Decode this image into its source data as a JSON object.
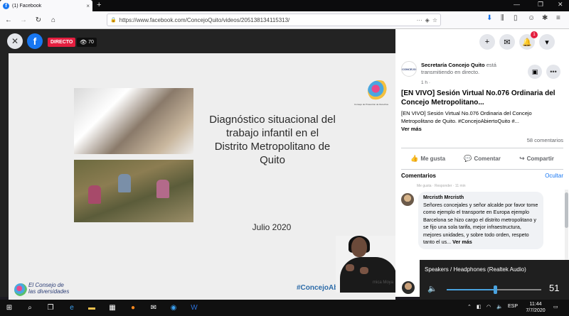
{
  "browser": {
    "tab_title": "(1) Facebook",
    "tab_close": "×",
    "new_tab": "+",
    "url": "https://www.facebook.com/ConcejoQuito/videos/205138134115313/",
    "url_more": "···",
    "win_min": "—",
    "win_max": "❐",
    "win_close": "✕"
  },
  "video": {
    "live_label": "DIRECTO",
    "viewers": "70",
    "slide": {
      "title": "Diagnóstico situacional del trabajo infantil en el Distrito Metropolitano de Quito",
      "date": "Julio 2020",
      "logo_caption_line1": "El Consejo de",
      "logo_caption_line2": "las diversidades",
      "top_logo_text": "Consejo de Protección de Derechos",
      "hashtag": "#ConcejoAbiertoQuito",
      "interpreter_name": "mica Moya"
    }
  },
  "panel": {
    "notifications_badge": "1",
    "page_avatar_text": "CONCEJO",
    "page_name": "Secretaría Concejo Quito",
    "status": "está transmitiendo en directo.",
    "time": "1 h ·",
    "post_title": "[EN VIVO] Sesión Virtual No.076 Ordinaria del Concejo Metropolitano...",
    "post_body": "[EN VIVO] Sesión Virtual No.076 Ordinaria del Concejo Metropolitano de Quito. #ConcejoAbiertoQuito #...",
    "see_more": "Ver más",
    "comments_count": "58 comentarios",
    "like": "Me gusta",
    "comment": "Comentar",
    "share": "Compartir",
    "comments_header": "Comentarios",
    "hide": "Ocultar",
    "ghost_line": "Me gusta · Responder · 11 min",
    "comment1": {
      "author": "Mrcristh Mrcristh",
      "text": "Señores concejales y señor alcalde por favor tome como ejemplo el transporte en Europa ejemplo Barcelona se hizo cargo el distrito metropolitano y se fijo una sola tarifa, mejor infraestructura, mejores unidades, y sobre todo orden, respeto tanto el us...",
      "see_more": "Ver más"
    }
  },
  "volume": {
    "device": "Speakers / Headphones (Realtek Audio)",
    "level": 51,
    "level_text": "51"
  },
  "taskbar": {
    "lang": "ESP",
    "time": "11:44",
    "date": "7/7/2020"
  },
  "colors": {
    "facebook_blue": "#1877f2",
    "live_red": "#e41e3f",
    "volume_accent": "#4aa3df"
  }
}
